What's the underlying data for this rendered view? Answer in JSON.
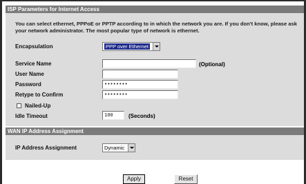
{
  "isp_section": {
    "title": "ISP Parameters for Internet Access",
    "intro": "You can select ethernet, PPPoE or PPTP according to in which the network you are. If you don't know, please ask your network administrator. The most popular type of network is ethernet."
  },
  "form": {
    "encapsulation_label": "Encapsulation",
    "encapsulation_value": "PPP over Ethernet",
    "service_name_label": "Service Name",
    "service_name_value": "",
    "service_name_suffix": "(Optional)",
    "user_name_label": "User Name",
    "user_name_value": "",
    "password_label": "Password",
    "password_value": "••••••••",
    "retype_label": "Retype to Confirm",
    "retype_value": "••••••••",
    "nailed_up_label": "Nailed-Up",
    "nailed_up_checked": false,
    "idle_timeout_label": "Idle Timeout",
    "idle_timeout_value": "100",
    "idle_timeout_suffix": "(Seconds)"
  },
  "wan_section": {
    "title": "WAN IP Address Assignment",
    "ip_assignment_label": "IP Address Assignment",
    "ip_assignment_value": "Dynamic"
  },
  "buttons": {
    "apply_label": "Apply",
    "reset_label": "Reset"
  }
}
